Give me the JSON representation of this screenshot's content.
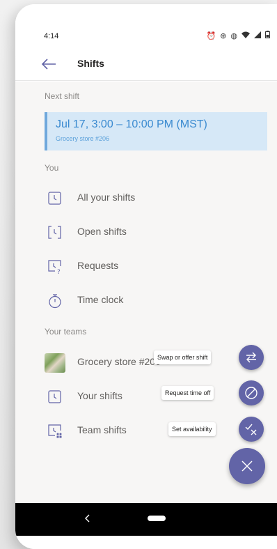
{
  "status_bar": {
    "time": "4:14",
    "icons": [
      "alarm-icon",
      "data-saver-icon",
      "vibrate-icon",
      "wifi-icon",
      "signal-icon",
      "battery-icon"
    ]
  },
  "header": {
    "title": "Shifts",
    "back_icon": "back-arrow-icon"
  },
  "next_shift": {
    "section_label": "Next shift",
    "time": "Jul 17, 3:00 – 10:00 PM (MST)",
    "store": "Grocery store #206",
    "accent_color": "#6fa8dc"
  },
  "you": {
    "section_label": "You",
    "items": [
      {
        "label": "All your shifts",
        "icon": "shift-clock-icon"
      },
      {
        "label": "Open shifts",
        "icon": "open-shift-icon"
      },
      {
        "label": "Requests",
        "icon": "requests-icon"
      },
      {
        "label": "Time clock",
        "icon": "stopwatch-icon"
      }
    ]
  },
  "teams": {
    "section_label": "Your teams",
    "items": [
      {
        "label": "Grocery store #206",
        "icon": "team-photo"
      },
      {
        "label": "Your shifts",
        "icon": "shift-clock-icon"
      },
      {
        "label": "Team shifts",
        "icon": "team-shift-icon"
      }
    ]
  },
  "fab_actions": [
    {
      "tooltip": "Swap or offer shift",
      "icon": "swap-icon"
    },
    {
      "tooltip": "Request time off",
      "icon": "time-off-icon"
    },
    {
      "tooltip": "Set availability",
      "icon": "availability-icon"
    }
  ],
  "fab_main": {
    "icon": "close-icon"
  },
  "colors": {
    "brand": "#6264a7",
    "card_bg": "#d6e8f7",
    "card_text": "#3a8ad0",
    "muted_text": "#8a8886",
    "body_text": "#605e5c"
  },
  "system_nav": {
    "back_icon": "nav-back-icon",
    "home_icon": "nav-home-pill"
  }
}
